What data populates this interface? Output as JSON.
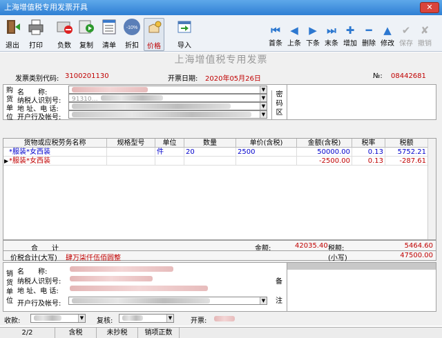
{
  "window": {
    "title": "上海增值税专用发票开具",
    "close": "✕"
  },
  "toolbar": {
    "exit": "退出",
    "print": "打印",
    "negative": "负数",
    "copy": "复制",
    "list": "清单",
    "discount": "折扣",
    "discount_badge": "-10%",
    "price": "价格",
    "import": "导入",
    "first": "首条",
    "prev": "上条",
    "next": "下条",
    "last": "末条",
    "add": "增加",
    "delete": "删除",
    "modify": "修改",
    "save": "保存",
    "undo": "撤销"
  },
  "invoice": {
    "title": "上海增值税专用发票",
    "type_code_label": "发票类别代码:",
    "type_code": "3100201130",
    "date_label": "开票日期:",
    "date": "2020年05月26日",
    "no_label": "№:",
    "no": "08442681"
  },
  "buyer": {
    "side_label": [
      "购",
      "货",
      "单",
      "位"
    ],
    "name_label": "名　　称:",
    "tax_id_label": "纳税人识别号:",
    "tax_id_partial": "91310…",
    "address_label": "地 址、电 话:",
    "bank_label": "开户行及帐号:",
    "cipher_label": [
      "密",
      "码",
      "区"
    ]
  },
  "table": {
    "headers": [
      "货物或应税劳务名称",
      "规格型号",
      "单位",
      "数量",
      "单价(含税)",
      "金额(含税)",
      "税率",
      "税额"
    ],
    "rows": [
      {
        "name": "*服装*女西装",
        "spec": "",
        "unit": "件",
        "qty": "20",
        "price": "2500",
        "amount": "50000.00",
        "rate": "0.13",
        "tax": "5752.21"
      },
      {
        "name": "*服装*女西装",
        "spec": "",
        "unit": "",
        "qty": "",
        "price": "",
        "amount": "-2500.00",
        "rate": "0.13",
        "tax": "-287.61"
      }
    ]
  },
  "summary": {
    "total_label": "合　　计",
    "amount_label": "金额:",
    "amount": "42035.40",
    "tax_label": "税额:",
    "tax": "5464.60",
    "total_words_label": "价税合计(大写)",
    "total_words": "肆万柒仟伍佰圆整",
    "small_label": "(小写)",
    "small": "47500.00"
  },
  "seller": {
    "side_label": [
      "销",
      "货",
      "单",
      "位"
    ],
    "name_label": "名　　称:",
    "tax_id_label": "纳税人识别号:",
    "address_label": "地 址、电 话:",
    "bank_label": "开户行及帐号:",
    "remark_label": [
      "备",
      "注"
    ]
  },
  "footer": {
    "payee_label": "收款:",
    "review_label": "复核:",
    "drawer_label": "开票:"
  },
  "status": {
    "page": "2/2",
    "tax_mode": "含税",
    "tax_state": "未抄税",
    "invoice_state": "销项正数"
  }
}
